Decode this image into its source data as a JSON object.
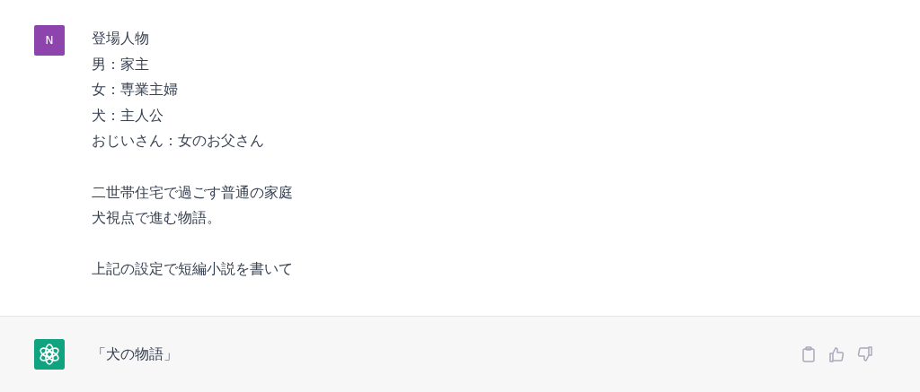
{
  "user_message": {
    "avatar": "N",
    "paragraphs": [
      {
        "lines": [
          "登場人物",
          "男：家主",
          "女：専業主婦",
          "犬：主人公",
          "おじいさん：女のお父さん"
        ]
      },
      {
        "lines": [
          "二世帯住宅で過ごす普通の家庭",
          "犬視点で進む物語。"
        ]
      },
      {
        "lines": [
          "上記の設定で短編小説を書いて"
        ]
      }
    ]
  },
  "assistant_message": {
    "text": "「犬の物語」"
  }
}
